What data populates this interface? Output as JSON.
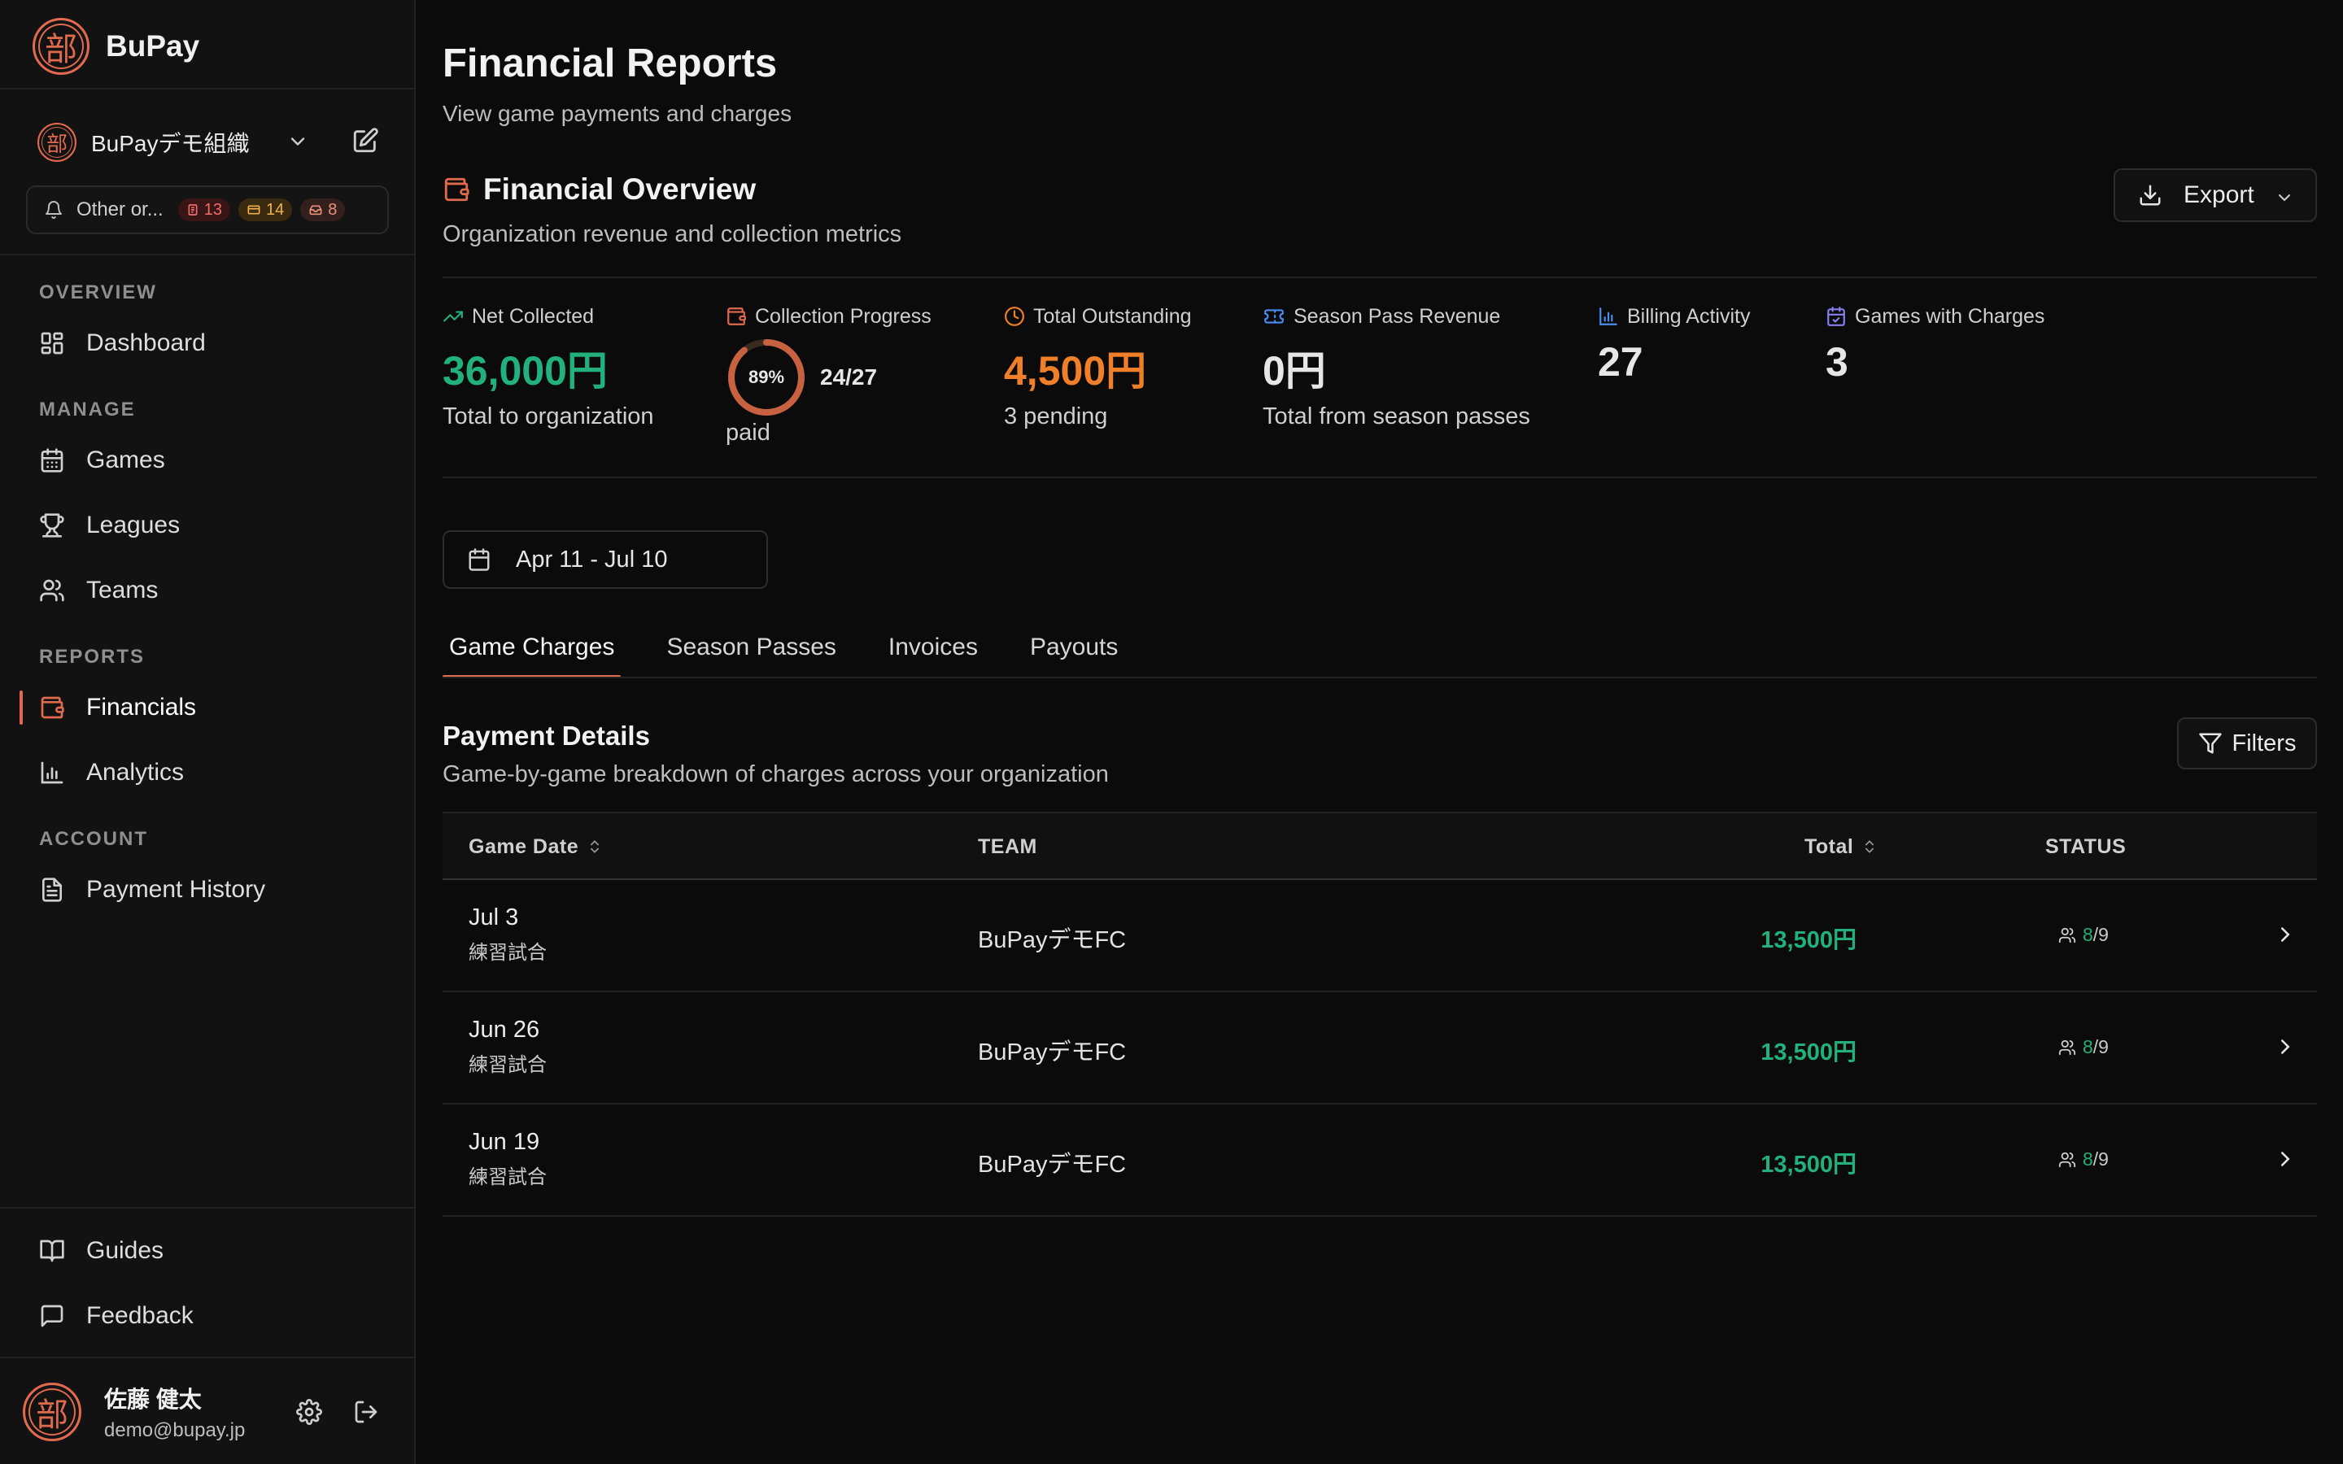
{
  "brand": {
    "logo_char": "部",
    "name": "BuPay"
  },
  "org": {
    "logo_char": "部",
    "name": "BuPayデモ組織"
  },
  "notifications": {
    "label": "Other or...",
    "red_count": "13",
    "amber_count": "14",
    "rose_count": "8"
  },
  "sidebar": {
    "sections": [
      {
        "label": "OVERVIEW"
      },
      {
        "label": "MANAGE"
      },
      {
        "label": "REPORTS"
      },
      {
        "label": "ACCOUNT"
      }
    ],
    "items": [
      {
        "label": "Dashboard",
        "icon": "dashboard-icon"
      },
      {
        "label": "Games",
        "icon": "calendar-icon"
      },
      {
        "label": "Leagues",
        "icon": "trophy-icon"
      },
      {
        "label": "Teams",
        "icon": "users-icon"
      },
      {
        "label": "Financials",
        "icon": "wallet-icon",
        "active": true
      },
      {
        "label": "Analytics",
        "icon": "bar-chart-icon"
      },
      {
        "label": "Payment History",
        "icon": "receipt-icon"
      }
    ],
    "footer_items": [
      {
        "label": "Guides",
        "icon": "book-icon"
      },
      {
        "label": "Feedback",
        "icon": "message-icon"
      }
    ]
  },
  "user": {
    "avatar_char": "部",
    "name": "佐藤 健太",
    "email": "demo@bupay.jp"
  },
  "page": {
    "title": "Financial Reports",
    "subtitle": "View game payments and charges"
  },
  "overview": {
    "title": "Financial Overview",
    "subtitle": "Organization revenue and collection metrics",
    "export_label": "Export",
    "metrics": [
      {
        "label": "Net Collected",
        "value": "36,000円",
        "note": "Total to organization",
        "color": "#22b07d",
        "icon": "trending-up-icon"
      },
      {
        "label": "Collection Progress",
        "percent_label": "89%",
        "percent": 0.89,
        "count": "24/27",
        "note": "paid",
        "color": "#e06a4e",
        "icon": "wallet-icon"
      },
      {
        "label": "Total Outstanding",
        "value": "4,500円",
        "note": "3 pending",
        "color": "#f07f2a",
        "icon": "clock-icon"
      },
      {
        "label": "Season Pass Revenue",
        "value": "0円",
        "note": "Total from season passes",
        "color": "#e6e6e6",
        "icon": "ticket-icon"
      },
      {
        "label": "Billing Activity",
        "value": "27",
        "note": "",
        "color": "#e6e6e6",
        "icon": "bar-chart-icon"
      },
      {
        "label": "Games with Charges",
        "value": "3",
        "note": "",
        "color": "#e6e6e6",
        "icon": "calendar-check-icon"
      }
    ]
  },
  "date_range": "Apr 11 - Jul 10",
  "tabs": [
    {
      "label": "Game Charges",
      "active": true
    },
    {
      "label": "Season Passes"
    },
    {
      "label": "Invoices"
    },
    {
      "label": "Payouts"
    }
  ],
  "payment_details": {
    "title": "Payment Details",
    "subtitle": "Game-by-game breakdown of charges across your organization",
    "filters_label": "Filters",
    "columns": {
      "date": "Game Date",
      "team": "TEAM",
      "total": "Total",
      "status": "STATUS"
    },
    "rows": [
      {
        "date": "Jul 3",
        "type": "練習試合",
        "team": "BuPayデモFC",
        "total": "13,500円",
        "paid": "8",
        "total_players": "/9"
      },
      {
        "date": "Jun 26",
        "type": "練習試合",
        "team": "BuPayデモFC",
        "total": "13,500円",
        "paid": "8",
        "total_players": "/9"
      },
      {
        "date": "Jun 19",
        "type": "練習試合",
        "team": "BuPayデモFC",
        "total": "13,500円",
        "paid": "8",
        "total_players": "/9"
      }
    ]
  },
  "colors": {
    "accent": "#e06a4e",
    "positive": "#22b07d",
    "warning": "#f07f2a",
    "info_blue": "#4a8df0",
    "purple": "#8a7ff0"
  }
}
